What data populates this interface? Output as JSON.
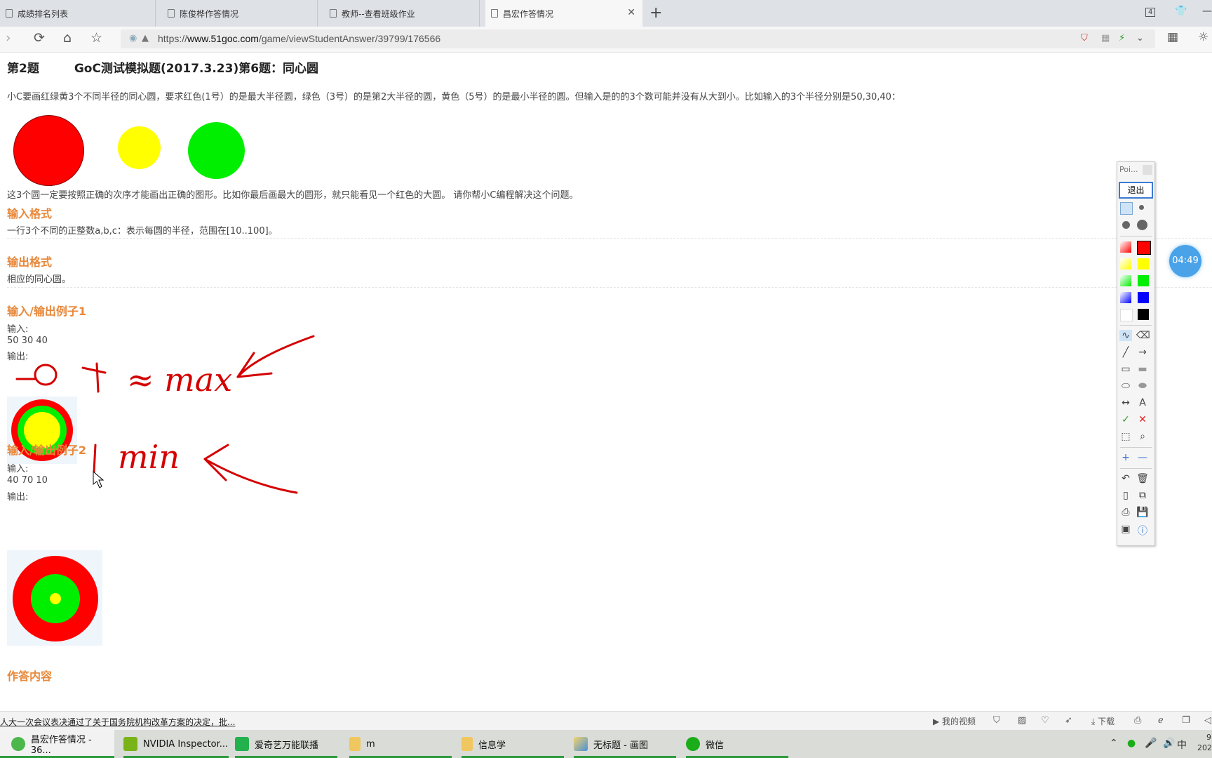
{
  "browser": {
    "tabs": [
      {
        "label": "成绩排名列表"
      },
      {
        "label": "陈俊桦作答情况"
      },
      {
        "label": "教师--查看班级作业"
      },
      {
        "label": "昌宏作答情况"
      }
    ],
    "tab_count": "4",
    "url_prefix": "https://",
    "url_domain": "www.51goc.com",
    "url_path": "/game/viewStudentAnswer/39799/176566"
  },
  "question": {
    "number": "第2题",
    "title": "GoC测试模拟题(2017.3.23)第6题：同心圆",
    "description": "小C要画红绿黄3个不同半径的同心圆，要求红色(1号）的是最大半径圆，绿色（3号）的是第2大半径的圆，黄色（5号）的是最小半径的圆。但输入是的的3个数可能并没有从大到小。比如输入的3个半径分别是50,30,40：",
    "note": "这3个圆一定要按照正确的次序才能画出正确的图形。比如你最后画最大的圆形，就只能看见一个红色的大圆。 请你帮小C编程解决这个问题。",
    "input_heading": "输入格式",
    "input_text": "一行3个不同的正整数a,b,c：表示每圆的半径，范围在[10..100]。",
    "output_heading": "输出格式",
    "output_text": "相应的同心圆。",
    "example1_heading": "输入/输出例子1",
    "example1_input_label": "输入:",
    "example1_input": "50 30 40",
    "example1_output_label": "输出:",
    "example2_heading": "输入/输出例子2",
    "example2_input_label": "输入:",
    "example2_input": "40 70 10",
    "example2_output_label": "输出:",
    "answer_heading": "作答内容"
  },
  "annotations": {
    "top_text": "≈ max",
    "bottom_text": "min",
    "ink_color": "#d40000"
  },
  "pen_toolbar": {
    "title": "Poi...",
    "exit_label": "退出",
    "colors": [
      "#ff0000",
      "#ffff00",
      "#00ee00",
      "#0000ff",
      "#000000"
    ]
  },
  "timer": "04:49",
  "status_bar": {
    "news": "人大一次会议表决通过了关于国务院机构改革方案的决定，批...",
    "my_video": "我的视频",
    "download": "下载"
  },
  "taskbar": {
    "items": [
      {
        "label": "昌宏作答情况 - 36..."
      },
      {
        "label": "NVIDIA Inspector..."
      },
      {
        "label": "爱奇艺万能联播"
      },
      {
        "label": "m"
      },
      {
        "label": "信息学"
      },
      {
        "label": "无标题 - 画图"
      },
      {
        "label": "微信"
      }
    ],
    "ime": "中",
    "clock_top": "9",
    "clock_bottom": "202"
  },
  "colors": {
    "section_heading": "#e8883a",
    "red": "#ff0000",
    "green": "#00ee00",
    "yellow": "#ffff00"
  }
}
